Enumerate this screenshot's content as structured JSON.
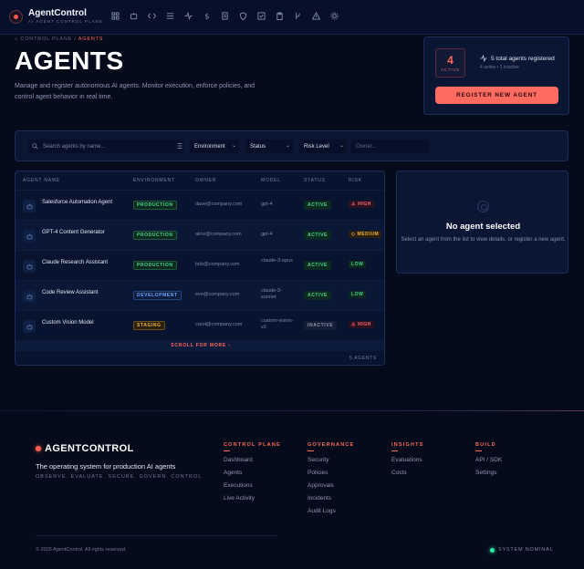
{
  "app": {
    "name": "AgentControl",
    "subtitle": "AI AGENT CONTROL PLANE"
  },
  "nav_icons": [
    "grid-icon",
    "robot-icon",
    "code-icon",
    "list-icon",
    "activity-icon",
    "dollar-icon",
    "document-icon",
    "shield-icon",
    "check-square-icon",
    "clipboard-icon",
    "branch-icon",
    "alert-icon",
    "gear-icon"
  ],
  "breadcrumb": {
    "root": "CONTROL PLANE",
    "separator": "/",
    "current": "AGENTS"
  },
  "page": {
    "title": "AGENTS",
    "description": "Manage and register autonomous AI agents. Monitor execution, enforce policies, and control agent behavior in real time."
  },
  "stats": {
    "active_count": "4",
    "active_label": "ACTIVE",
    "total_line": "5 total agents registered",
    "sub_line": "4 active  •  1 inactive",
    "register_label": "REGISTER NEW AGENT"
  },
  "filters": {
    "search_placeholder": "Search agents by name...",
    "environment": "Environment",
    "status": "Status",
    "risk": "Risk Level",
    "owner_placeholder": "Owner..."
  },
  "table": {
    "headers": [
      "AGENT NAME",
      "ENVIRONMENT",
      "OWNER",
      "MODEL",
      "STATUS",
      "RISK"
    ],
    "rows": [
      {
        "name": "Salesforce Automation Agent",
        "env": "PRODUCTION",
        "owner": "dave@company.com",
        "model": "gpt-4",
        "status": "ACTIVE",
        "risk": "HIGH"
      },
      {
        "name": "GPT-4 Content Generator",
        "env": "PRODUCTION",
        "owner": "alice@company.com",
        "model": "gpt-4",
        "status": "ACTIVE",
        "risk": "MEDIUM"
      },
      {
        "name": "Claude Research Assistant",
        "env": "PRODUCTION",
        "owner": "bob@company.com",
        "model": "claude-3-opus",
        "status": "ACTIVE",
        "risk": "LOW"
      },
      {
        "name": "Code Review Assistant",
        "env": "DEVELOPMENT",
        "owner": "eve@company.com",
        "model": "claude-3-sonnet",
        "status": "ACTIVE",
        "risk": "LOW"
      },
      {
        "name": "Custom Vision Model",
        "env": "STAGING",
        "owner": "carol@company.com",
        "model": "custom-vision-v2",
        "status": "INACTIVE",
        "risk": "HIGH"
      }
    ],
    "scroll_label": "SCROLL FOR MORE",
    "count_label": "5 AGENTS"
  },
  "detail": {
    "title": "No agent selected",
    "text": "Select an agent from the list to view details, or register a new agent."
  },
  "footer": {
    "brand": "AGENTCONTROL",
    "tagline": "The operating system for production AI agents",
    "tagline2": "OBSERVE. EVALUATE. SECURE. GOVERN. CONTROL.",
    "columns": [
      {
        "heading": "CONTROL PLANE",
        "links": [
          "Dashboard",
          "Agents",
          "Executions",
          "Live Activity"
        ]
      },
      {
        "heading": "GOVERNANCE",
        "links": [
          "Security",
          "Policies",
          "Approvals",
          "Incidents",
          "Audit Logs"
        ]
      },
      {
        "heading": "INSIGHTS",
        "links": [
          "Evaluations",
          "Costs"
        ]
      },
      {
        "heading": "BUILD",
        "links": [
          "API / SDK",
          "Settings"
        ]
      }
    ],
    "copyright": "© 2026 AgentControl. All rights reserved.",
    "system_status": "SYSTEM NOMINAL"
  },
  "colors": {
    "accent": "#ff6b61",
    "background": "#050b1a",
    "success": "#4cd48a"
  }
}
